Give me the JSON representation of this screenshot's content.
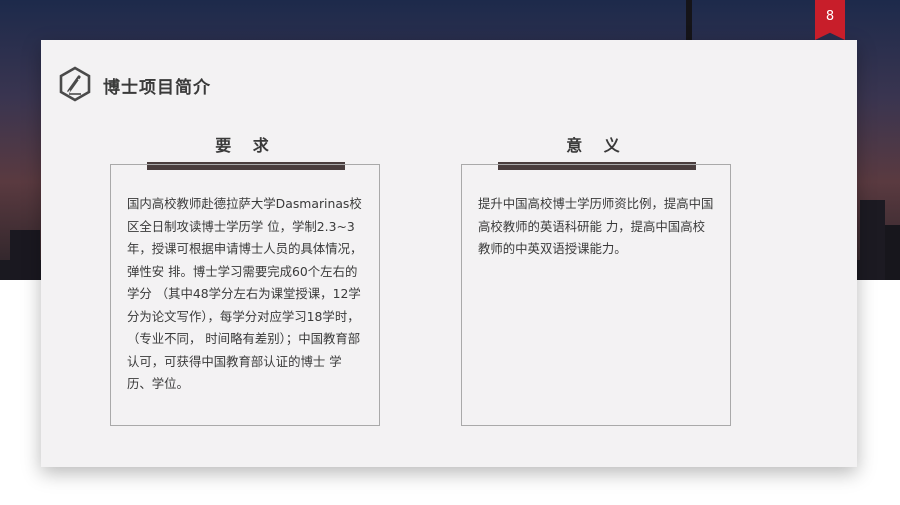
{
  "page_number": "8",
  "title": "博士项目简介",
  "sections": [
    {
      "heading": "要 求",
      "body": "国内高校教师赴德拉萨大学Dasmarinas校区全日制攻读博士学历学 位，学制2.3~3年，授课可根据申请博士人员的具体情况，弹性安 排。博士学习需要完成60个左右的学分 （其中48学分左右为课堂授课，12学分为论文写作），每学分对应学习18学时，（专业不同， 时间略有差别）；中国教育部认可，可获得中国教育部认证的博士 学历、学位。"
    },
    {
      "heading": "意 义",
      "body": "提升中国高校博士学历师资比例，提高中国高校教师的英语科研能 力，提高中国高校教师的中英双语授课能力。"
    }
  ],
  "colors": {
    "badge": "#c81e2a",
    "card": "#f3f2f3",
    "bar": "#4a3e3e",
    "text": "#3a3a3a"
  },
  "icons": {
    "title_icon": "hexagon-pencil-icon"
  }
}
